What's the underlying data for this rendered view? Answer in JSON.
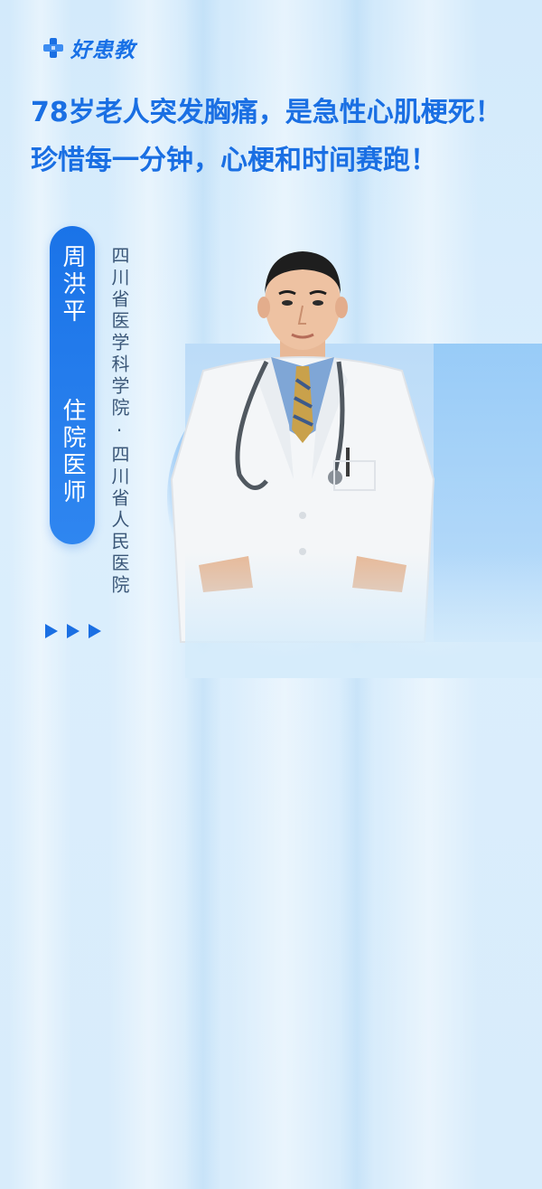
{
  "brand": {
    "name": "好患教",
    "icon": "medical-cross-logo-icon",
    "color": "#1870e6"
  },
  "headline": {
    "line1": "78岁老人突发胸痛，是急性心肌梗死！",
    "line2": "珍惜每一分钟，心梗和时间赛跑！",
    "color": "#1a6fe3"
  },
  "doctor": {
    "name": "周洪平",
    "title": "住院医师",
    "hospital": "四川省医学科学院·四川省人民医院",
    "photo": "doctor-portrait-photo"
  },
  "decor": {
    "arrows_icon": "triple-arrow-icon",
    "accent": "#1a73e8"
  }
}
